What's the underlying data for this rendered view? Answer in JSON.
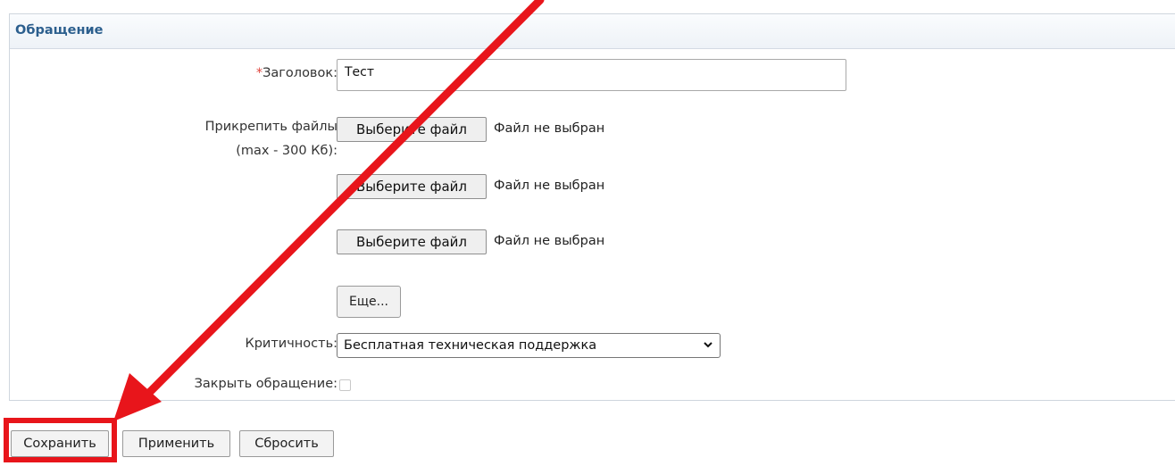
{
  "panel": {
    "title": "Обращение"
  },
  "form": {
    "title_label_required_mark": "*",
    "title_label": "Заголовок:",
    "title_value": "Тест",
    "attach_label_line1": "Прикрепить файлы",
    "attach_label_line2": "(max - 300 Кб):",
    "files": [
      {
        "button": "Выберите файл",
        "status": "Файл не выбран"
      },
      {
        "button": "Выберите файл",
        "status": "Файл не выбран"
      },
      {
        "button": "Выберите файл",
        "status": "Файл не выбран"
      }
    ],
    "more_button": "Еще...",
    "criticality_label": "Критичность:",
    "criticality_value": "Бесплатная техническая поддержка",
    "close_label": "Закрыть обращение:",
    "close_checked": false
  },
  "actions": {
    "save": "Сохранить",
    "apply": "Применить",
    "reset": "Сбросить"
  },
  "annotation": {
    "color": "#e8151b"
  }
}
